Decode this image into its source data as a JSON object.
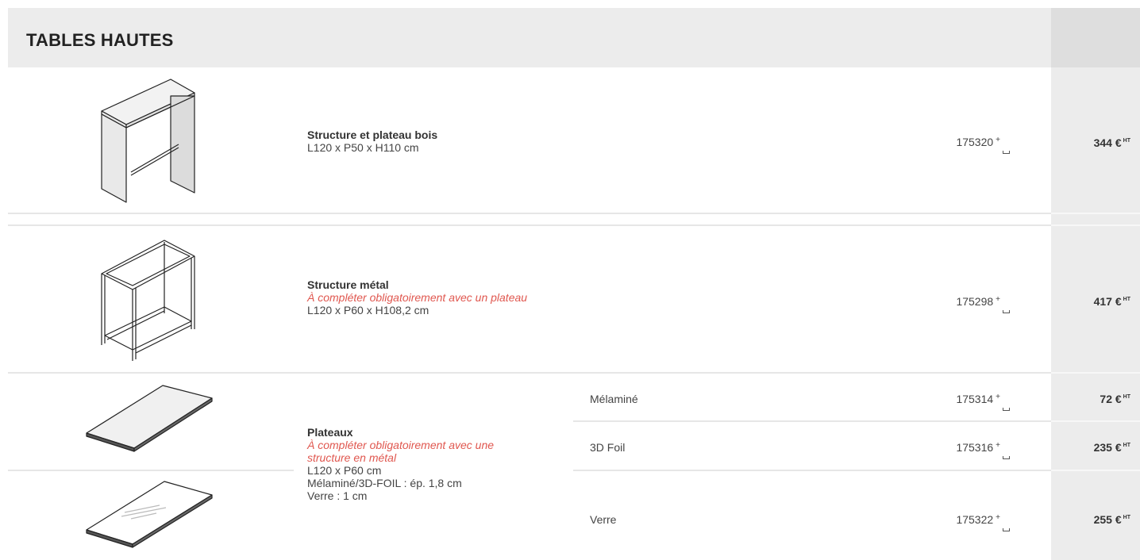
{
  "section_title": "TABLES HAUTES",
  "currency_suffix": "HT",
  "rows": [
    {
      "title": "Structure et plateau bois",
      "note": "",
      "details": [
        "L120 x P50 x H110 cm"
      ],
      "ref": "175320",
      "ref_plus": "+",
      "price": "344 €"
    },
    {
      "title": "Structure métal",
      "note": "À compléter obligatoirement avec un plateau",
      "details": [
        "L120 x P60 x H108,2 cm"
      ],
      "ref": "175298",
      "ref_plus": "+",
      "price": "417 €"
    }
  ],
  "plateaux": {
    "title": "Plateaux",
    "note_line1": "À compléter obligatoirement avec une",
    "note_line2": "structure en métal",
    "details": [
      "L120 x P60 cm",
      "Mélaminé/3D-FOIL : ép. 1,8 cm",
      "Verre : 1 cm"
    ],
    "options": [
      {
        "finish": "Mélaminé",
        "ref": "175314",
        "ref_plus": "+",
        "price": "72 €"
      },
      {
        "finish": "3D Foil",
        "ref": "175316",
        "ref_plus": "+",
        "price": "235 €"
      },
      {
        "finish": "Verre",
        "ref": "175322",
        "ref_plus": "+",
        "price": "255 €"
      }
    ]
  }
}
